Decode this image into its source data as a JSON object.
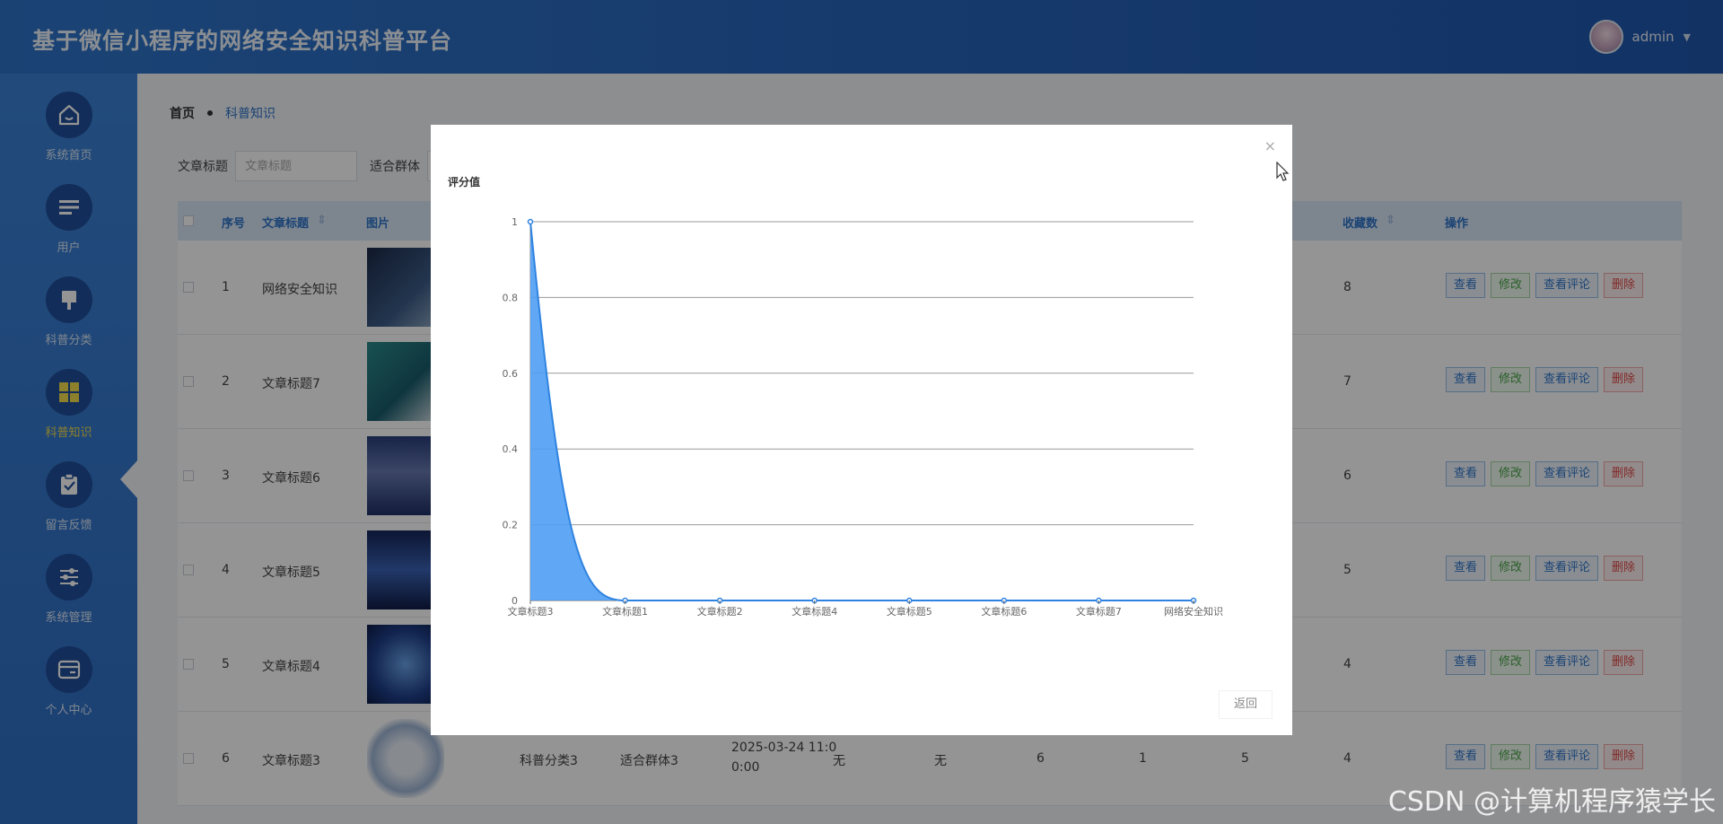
{
  "header": {
    "title": "基于微信小程序的网络安全知识科普平台",
    "user_name": "admin"
  },
  "sidebar": {
    "items": [
      {
        "label": "系统首页",
        "icon": "home-icon"
      },
      {
        "label": "用户",
        "icon": "list-icon"
      },
      {
        "label": "科普分类",
        "icon": "brush-icon"
      },
      {
        "label": "科普知识",
        "icon": "grid-icon",
        "active": true
      },
      {
        "label": "留言反馈",
        "icon": "clipboard-icon"
      },
      {
        "label": "系统管理",
        "icon": "sliders-icon"
      },
      {
        "label": "个人中心",
        "icon": "wallet-icon"
      }
    ]
  },
  "breadcrumb": {
    "home": "首页",
    "current": "科普知识"
  },
  "search": {
    "title_label": "文章标题",
    "title_placeholder": "文章标题",
    "group_label": "适合群体"
  },
  "table": {
    "headers": {
      "index": "序号",
      "title": "文章标题",
      "image": "图片",
      "favorites": "收藏数",
      "actions": "操作"
    },
    "rows": [
      {
        "index": "1",
        "title": "网络安全知识",
        "favorites": "8"
      },
      {
        "index": "2",
        "title": "文章标题7",
        "favorites": "7"
      },
      {
        "index": "3",
        "title": "文章标题6",
        "favorites": "6"
      },
      {
        "index": "4",
        "title": "文章标题5",
        "favorites": "5"
      },
      {
        "index": "5",
        "title": "文章标题4",
        "favorites": "4"
      },
      {
        "index": "6",
        "title": "文章标题3",
        "category": "科普分类3",
        "group": "适合群体3",
        "date_line1": "2025-03-24 11:0",
        "date_line2": "0:00",
        "col_a": "无",
        "col_b": "无",
        "col_c": "6",
        "col_d": "1",
        "col_e": "5",
        "favorites": "4"
      }
    ],
    "actions": {
      "view": "查看",
      "edit": "修改",
      "comments": "查看评论",
      "delete": "删除"
    }
  },
  "dialog": {
    "close_glyph": "×",
    "back_label": "返回"
  },
  "chart_data": {
    "type": "area",
    "title": "评分值",
    "categories": [
      "文章标题3",
      "文章标题1",
      "文章标题2",
      "文章标题4",
      "文章标题5",
      "文章标题6",
      "文章标题7",
      "网络安全知识"
    ],
    "values": [
      1,
      0,
      0,
      0,
      0,
      0,
      0,
      0
    ],
    "ylim": [
      0,
      1
    ],
    "yticks": [
      "0",
      "0.2",
      "0.4",
      "0.6",
      "0.8",
      "1"
    ],
    "grid": true,
    "smooth": true,
    "color": "#4f9ef4"
  },
  "watermark": "CSDN @计算机程序猿学长"
}
